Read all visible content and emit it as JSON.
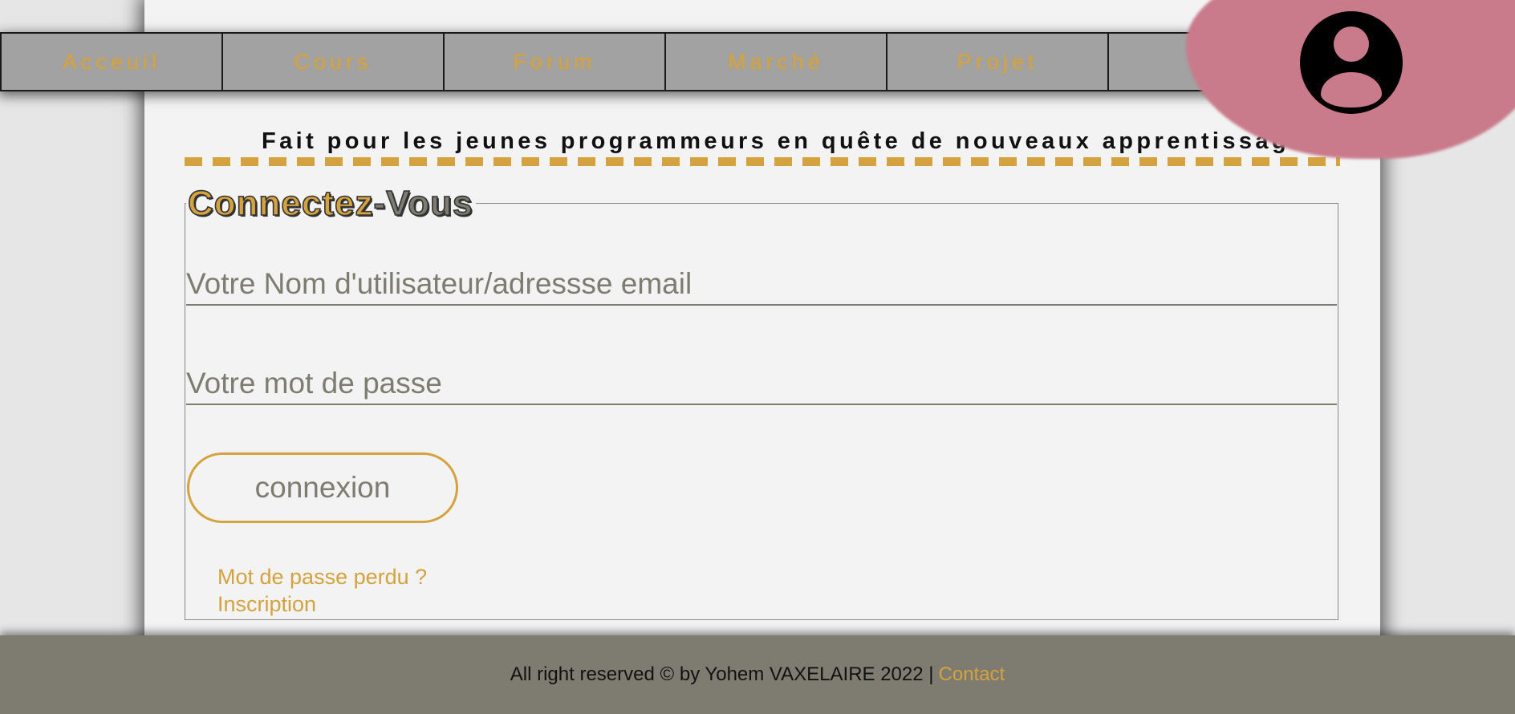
{
  "nav": {
    "items": [
      {
        "label": "Acceuil"
      },
      {
        "label": "Cours"
      },
      {
        "label": "Forum"
      },
      {
        "label": "Marché"
      },
      {
        "label": "Projet"
      },
      {
        "label": ""
      }
    ]
  },
  "profile": {
    "icon": "user-circle-icon"
  },
  "tagline": "Fait pour les jeunes programmeurs en quête de nouveaux apprentissages",
  "login": {
    "legend_part1": "Connectez",
    "legend_part2": "-Vous",
    "username_placeholder": "Votre Nom d'utilisateur/adressse email",
    "password_placeholder": "Votre mot de passe",
    "submit_label": "connexion",
    "forgot_link": "Mot de passe perdu ?",
    "signup_link": "Inscription"
  },
  "footer": {
    "text": "All right reserved © by Yohem VAXELAIRE 2022 |",
    "contact_link": "Contact"
  },
  "colors": {
    "accent": "#d4a23e",
    "grey": "#7e7c70",
    "nav_bg": "#a2a2a2",
    "profile_bg": "#c97b8b",
    "page_bg": "#f3f3f3"
  }
}
